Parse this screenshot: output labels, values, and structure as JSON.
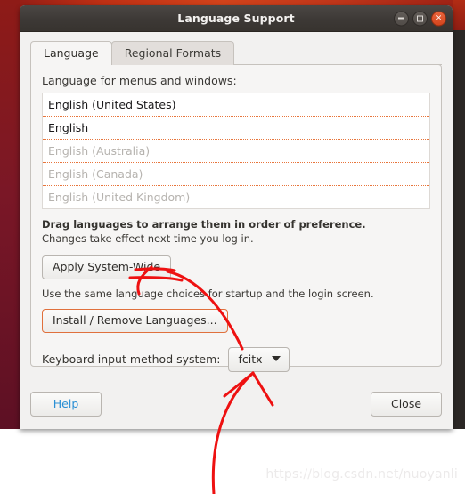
{
  "window": {
    "title": "Language Support",
    "controls": [
      {
        "name": "minimize",
        "glyph": "minus"
      },
      {
        "name": "maximize",
        "glyph": "square"
      },
      {
        "name": "close",
        "glyph": "x"
      }
    ],
    "close_glyph": "×"
  },
  "tabs": [
    {
      "label": "Language",
      "active": true
    },
    {
      "label": "Regional Formats",
      "active": false
    }
  ],
  "panel": {
    "list_label": "Language for menus and windows:",
    "languages": [
      {
        "label": "English (United States)",
        "enabled": true
      },
      {
        "label": "English",
        "enabled": true
      },
      {
        "label": "English (Australia)",
        "enabled": false
      },
      {
        "label": "English (Canada)",
        "enabled": false
      },
      {
        "label": "English (United Kingdom)",
        "enabled": false
      }
    ],
    "hint_drag": "Drag languages to arrange them in order of preference.",
    "hint_changes": "Changes take effect next time you log in.",
    "apply_button": "Apply System-Wide",
    "apply_hint": "Use the same language choices for startup and the login screen.",
    "install_button": "Install / Remove Languages...",
    "keyboard_label": "Keyboard input method system:",
    "keyboard_value": "fcitx"
  },
  "actions": {
    "help": "Help",
    "close": "Close"
  },
  "watermark": "https://blog.csdn.net/nuoyanli",
  "colors": {
    "accent_orange": "#e8753b",
    "close_button": "#d4451d",
    "help_link": "#2a8fd4",
    "annotation_red": "#ee1111",
    "titlebar": "#3d3936",
    "panel_bg": "#f6f5f4"
  }
}
